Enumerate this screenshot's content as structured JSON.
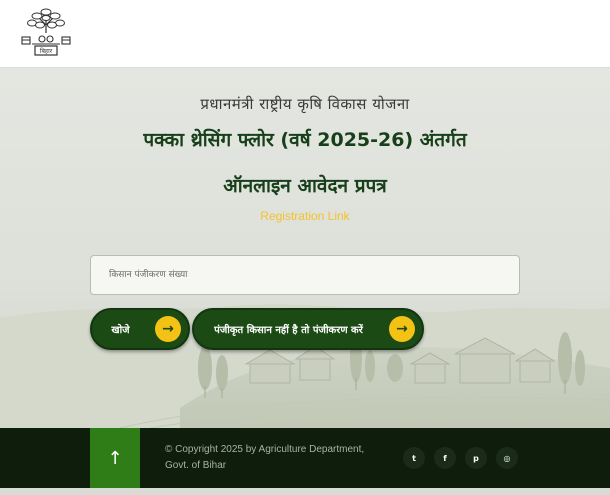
{
  "header": {
    "logo_alt": "बिहार सरकार",
    "logo_text": "बिहार"
  },
  "main": {
    "scheme_name": "प्रधानमंत्री  राष्ट्रीय  कृषि  विकास  योजना",
    "title_line1": "पक्का थ्रेसिंग फ्लोर (वर्ष 2025-26) अंतर्गत",
    "title_line2": "ऑनलाइन आवेदन प्रपत्र",
    "registration_link": "Registration Link",
    "search_placeholder": "किसान पंजीकरण संख्या",
    "search_button": "खोजे",
    "register_button": "पंजीकृत किसान नहीं है तो पंजीकरण करें"
  },
  "footer": {
    "copyright": "© Copyright 2025 by Agriculture Department, Govt. of Bihar",
    "top_icon": "arrow-up-icon",
    "social": [
      {
        "name": "twitter-icon",
        "glyph": "t"
      },
      {
        "name": "facebook-icon",
        "glyph": "f"
      },
      {
        "name": "pinterest-icon",
        "glyph": "p"
      },
      {
        "name": "instagram-icon",
        "glyph": "◎"
      }
    ]
  },
  "colors": {
    "primary_green": "#1c4a15",
    "accent_yellow": "#f3c214",
    "footer_bg": "#0e1d0c",
    "title_color": "#173f1a"
  }
}
